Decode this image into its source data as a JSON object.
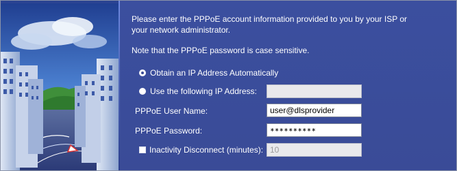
{
  "intro_text_line1": "Please enter the PPPoE account information provided to you by your ISP or",
  "intro_text_line2": "your network administrator.",
  "note_text": "Note that the PPPoE password is case sensitive.",
  "ip_options": {
    "auto_label": "Obtain an IP Address Automatically",
    "auto_selected": true,
    "manual_label": "Use the following IP Address:",
    "manual_value": ""
  },
  "fields": {
    "username_label": "PPPoE User Name:",
    "username_value": "user@dlsprovider",
    "password_label": "PPPoE Password:",
    "password_value": "∗∗∗∗∗∗∗∗∗∗"
  },
  "inactivity": {
    "label": "Inactivity Disconnect (minutes):",
    "checked": false,
    "value": "10"
  },
  "colors": {
    "panel_bg": "#3a4b97",
    "text": "#ffffff",
    "sky": "#2f5aa6"
  },
  "art": {
    "description_icon": "city-street-illustration"
  }
}
